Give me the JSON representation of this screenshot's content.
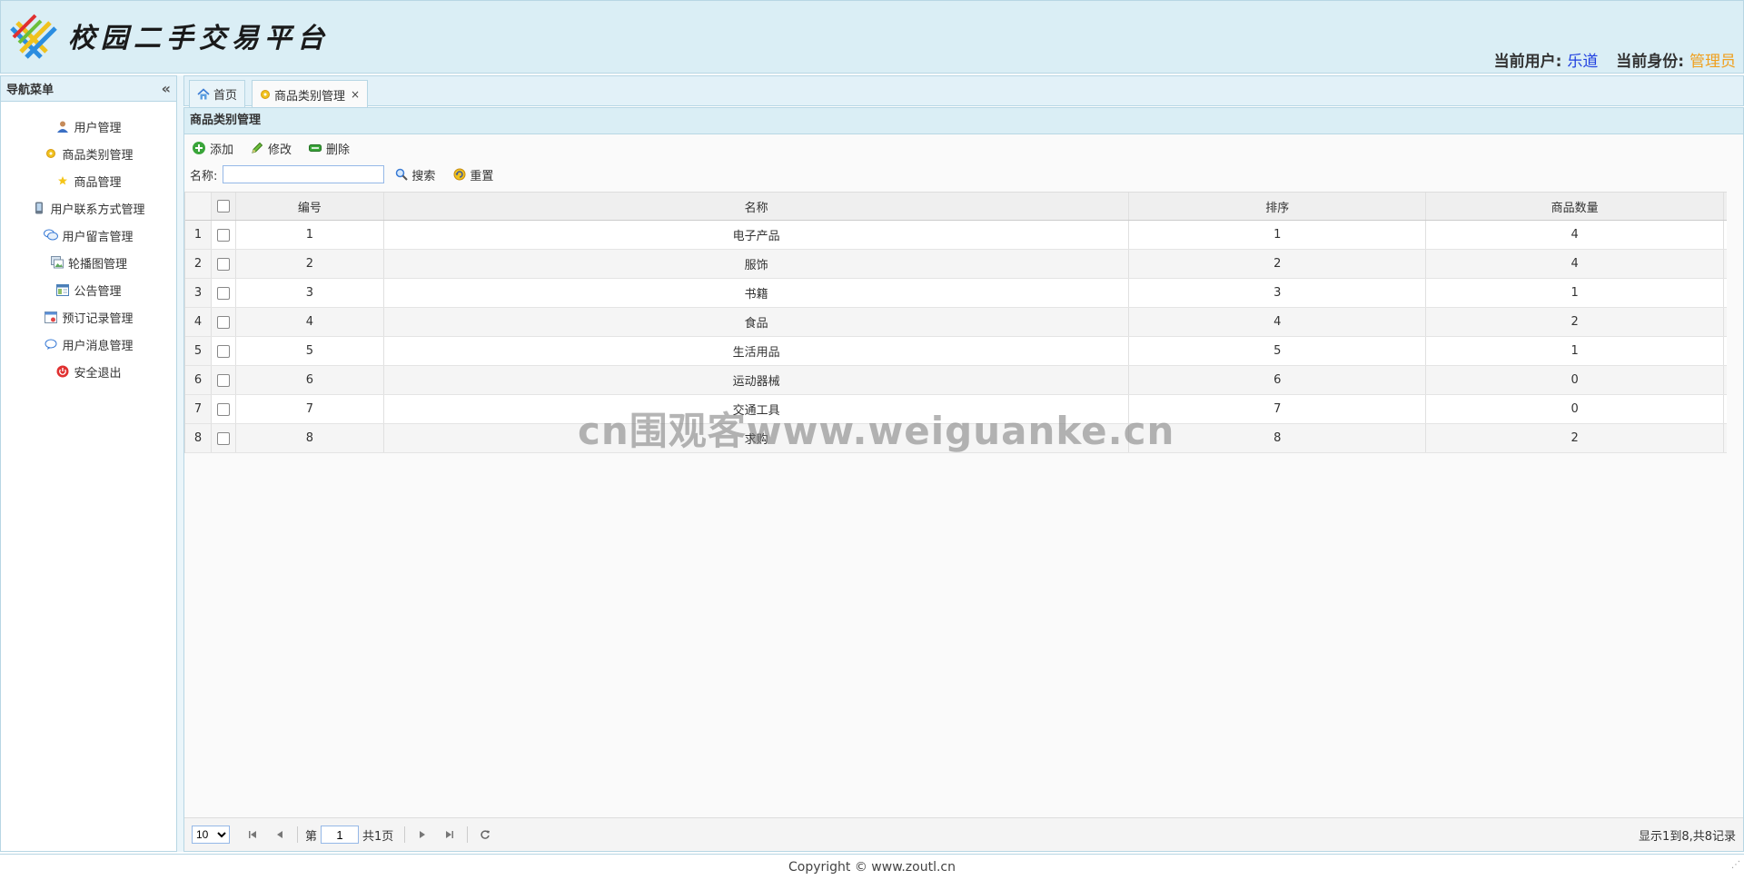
{
  "header": {
    "logo_text": "校园二手交易平台",
    "user_label": "当前用户:",
    "user_name": "乐道",
    "role_label": "当前身份:",
    "role_name": "管理员"
  },
  "sidebar": {
    "title": "导航菜单",
    "collapse_glyph": "«",
    "items": [
      {
        "label": "用户管理",
        "icon": "user-icon"
      },
      {
        "label": "商品类别管理",
        "icon": "gear-icon"
      },
      {
        "label": "商品管理",
        "icon": "star-icon"
      },
      {
        "label": "用户联系方式管理",
        "icon": "phone-icon"
      },
      {
        "label": "用户留言管理",
        "icon": "comments-icon"
      },
      {
        "label": "轮播图管理",
        "icon": "images-icon"
      },
      {
        "label": "公告管理",
        "icon": "notice-icon"
      },
      {
        "label": "预订记录管理",
        "icon": "calendar-icon"
      },
      {
        "label": "用户消息管理",
        "icon": "message-icon"
      },
      {
        "label": "安全退出",
        "icon": "power-icon"
      }
    ]
  },
  "tabs": [
    {
      "label": "首页",
      "icon": "home-icon"
    },
    {
      "label": "商品类别管理",
      "icon": "gear-icon",
      "close": "×"
    }
  ],
  "panel": {
    "title": "商品类别管理",
    "toolbar": {
      "add": "添加",
      "edit": "修改",
      "delete": "删除"
    },
    "search": {
      "label": "名称:",
      "value": "",
      "search_btn": "搜索",
      "reset_btn": "重置"
    }
  },
  "grid": {
    "columns": [
      "编号",
      "名称",
      "排序",
      "商品数量"
    ],
    "rows": [
      {
        "n": "1",
        "id": "1",
        "name": "电子产品",
        "sort": "1",
        "count": "4"
      },
      {
        "n": "2",
        "id": "2",
        "name": "服饰",
        "sort": "2",
        "count": "4"
      },
      {
        "n": "3",
        "id": "3",
        "name": "书籍",
        "sort": "3",
        "count": "1"
      },
      {
        "n": "4",
        "id": "4",
        "name": "食品",
        "sort": "4",
        "count": "2"
      },
      {
        "n": "5",
        "id": "5",
        "name": "生活用品",
        "sort": "5",
        "count": "1"
      },
      {
        "n": "6",
        "id": "6",
        "name": "运动器械",
        "sort": "6",
        "count": "0"
      },
      {
        "n": "7",
        "id": "7",
        "name": "交通工具",
        "sort": "7",
        "count": "0"
      },
      {
        "n": "8",
        "id": "8",
        "name": "求购",
        "sort": "8",
        "count": "2"
      }
    ]
  },
  "watermark": "cn围观客www.weiguanke.cn",
  "pager": {
    "page_size": "10",
    "page_label": "第",
    "page_value": "1",
    "total_pages": "共1页",
    "info": "显示1到8,共8记录"
  },
  "footer": {
    "copyright": "Copyright © www.zoutl.cn"
  },
  "colors": {
    "header_bg": "#daeef5",
    "border": "#b7d6e4",
    "user_name": "#1f3fe0",
    "role_name": "#f0a01e"
  }
}
